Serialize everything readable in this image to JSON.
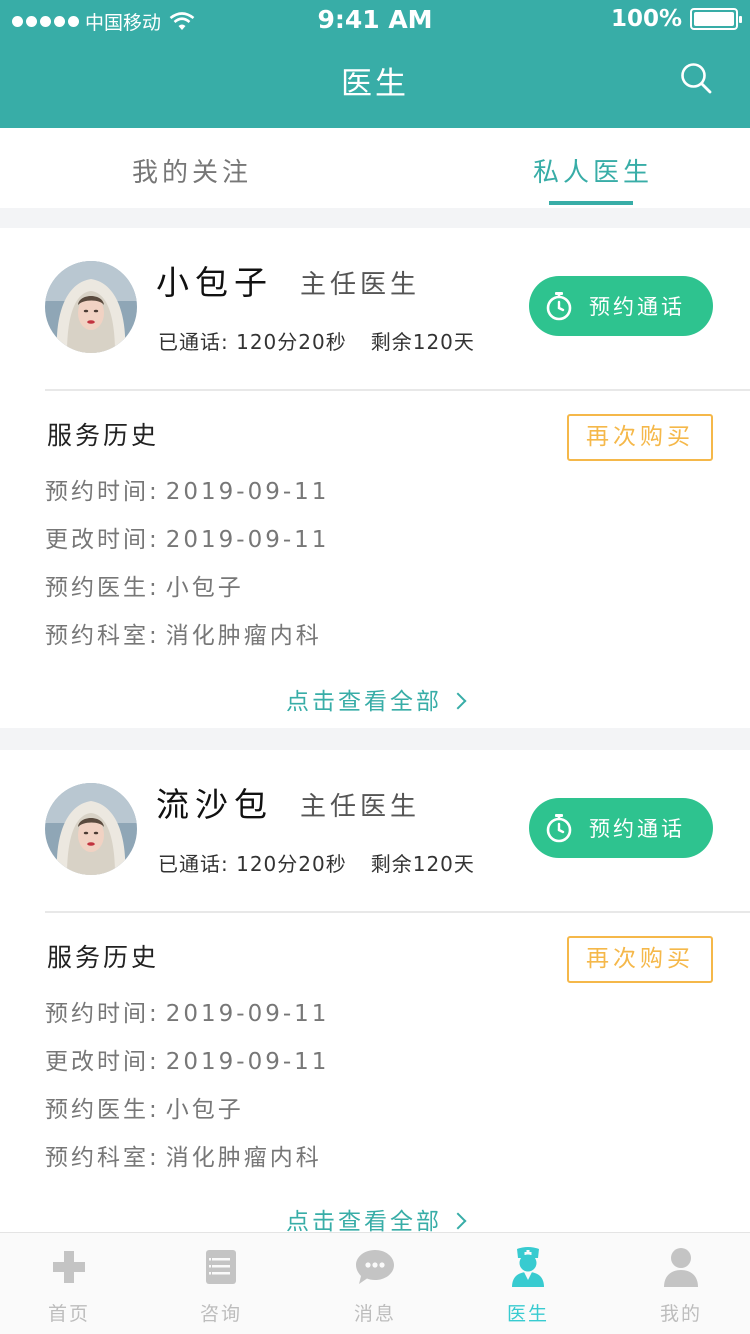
{
  "status_bar": {
    "carrier": "中国移动",
    "time": "9:41 AM",
    "battery": "100%",
    "battery_level": 1.0
  },
  "nav": {
    "title": "医生",
    "search_icon": "search-icon"
  },
  "tabs": [
    {
      "label": "我的关注",
      "active": false
    },
    {
      "label": "私人医生",
      "active": true
    }
  ],
  "doctors": [
    {
      "name": "小包子",
      "title": "主任医生",
      "talked_label": "已通话:",
      "talked_value": "120分20秒",
      "remaining": "剩余120天",
      "call_button": "预约通话",
      "history_title": "服务历史",
      "rebuy_button": "再次购买",
      "details": [
        {
          "label": "预约时间:",
          "value": "2019-09-11"
        },
        {
          "label": "更改时间:",
          "value": "2019-09-11"
        },
        {
          "label": "预约医生:",
          "value": "小包子"
        },
        {
          "label": "预约科室:",
          "value": "消化肿瘤内科"
        }
      ],
      "view_all": "点击查看全部"
    },
    {
      "name": "流沙包",
      "title": "主任医生",
      "talked_label": "已通话:",
      "talked_value": "120分20秒",
      "remaining": "剩余120天",
      "call_button": "预约通话",
      "history_title": "服务历史",
      "rebuy_button": "再次购买",
      "details": [
        {
          "label": "预约时间:",
          "value": "2019-09-11"
        },
        {
          "label": "更改时间:",
          "value": "2019-09-11"
        },
        {
          "label": "预约医生:",
          "value": "小包子"
        },
        {
          "label": "预约科室:",
          "value": "消化肿瘤内科"
        }
      ],
      "view_all": "点击查看全部"
    }
  ],
  "tabbar": [
    {
      "label": "首页",
      "icon": "plus-cross-icon",
      "active": false
    },
    {
      "label": "咨询",
      "icon": "document-list-icon",
      "active": false
    },
    {
      "label": "消息",
      "icon": "chat-bubble-icon",
      "active": false
    },
    {
      "label": "医生",
      "icon": "nurse-icon",
      "active": true
    },
    {
      "label": "我的",
      "icon": "user-icon",
      "active": false
    }
  ],
  "colors": {
    "primary": "#38ada7",
    "call_button": "#2ec38f",
    "rebuy": "#f5b84a",
    "tab_active": "#38cbd0",
    "tab_inactive": "#bdbdbd"
  }
}
